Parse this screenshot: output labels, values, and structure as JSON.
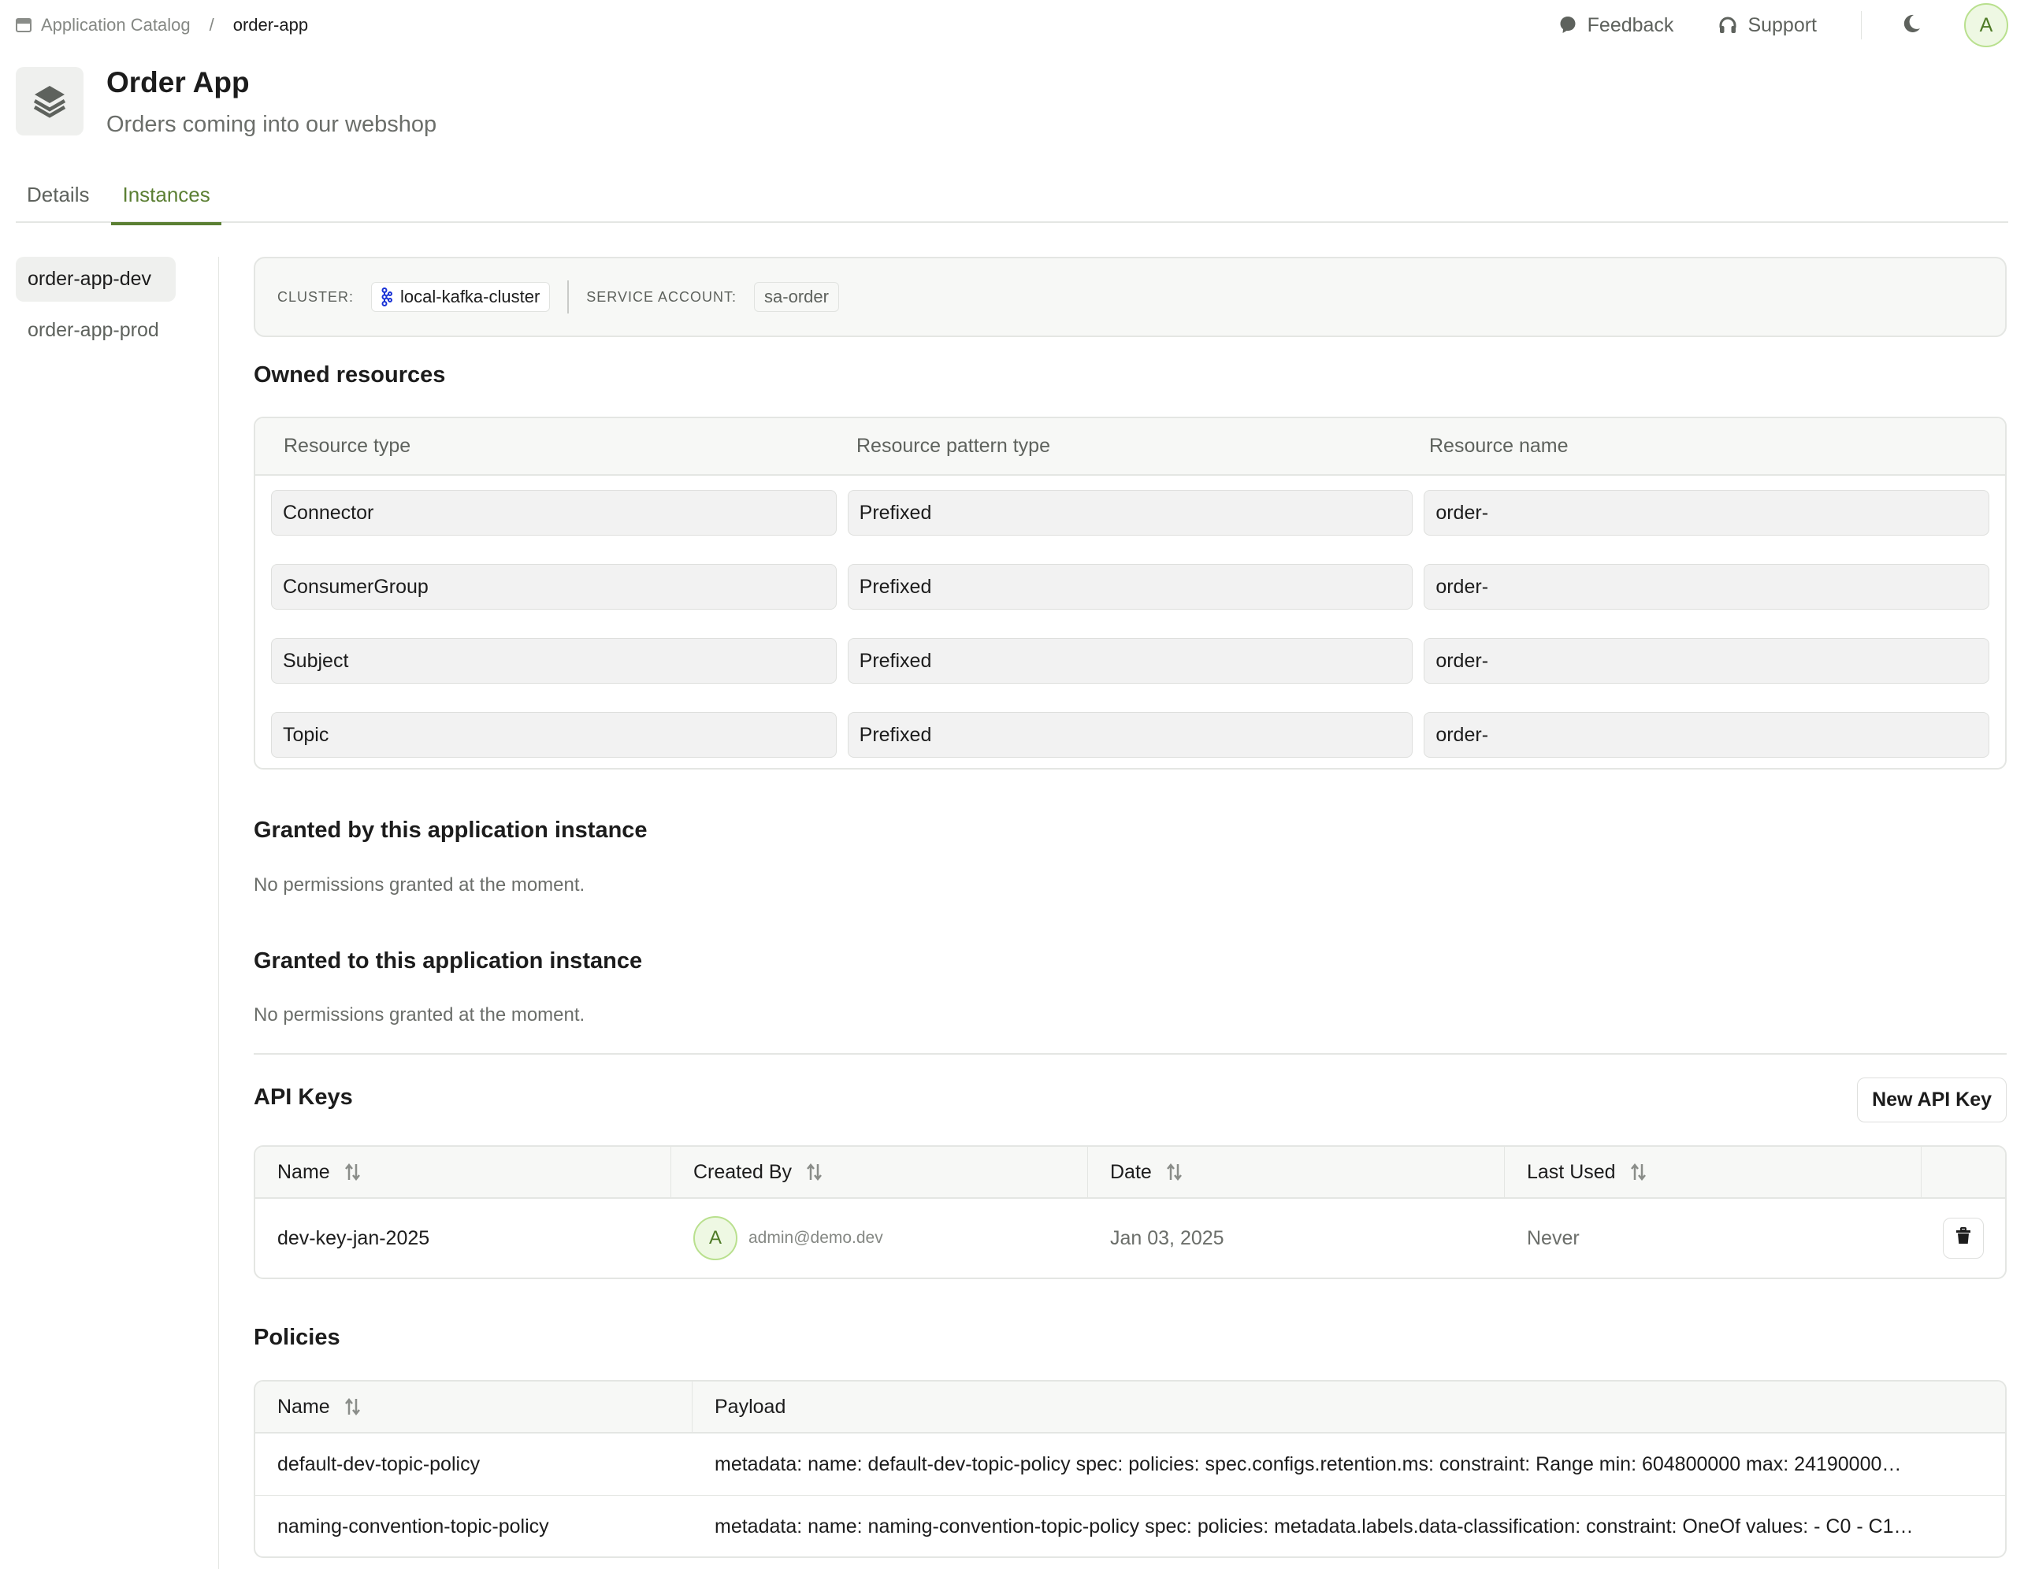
{
  "breadcrumb": {
    "icon": "app-window-icon",
    "parent": "Application Catalog",
    "separator": "/",
    "current": "order-app"
  },
  "topbar": {
    "feedback": {
      "label": "Feedback",
      "icon": "chat-bubble-icon"
    },
    "support": {
      "label": "Support",
      "icon": "headphones-icon"
    },
    "theme_toggle_icon": "moon-icon",
    "user_initial": "A"
  },
  "header": {
    "icon": "layers-icon",
    "title": "Order App",
    "subtitle": "Orders coming into our webshop"
  },
  "tabs": [
    {
      "label": "Details",
      "active": false
    },
    {
      "label": "Instances",
      "active": true
    }
  ],
  "instances": [
    {
      "label": "order-app-dev",
      "active": true
    },
    {
      "label": "order-app-prod",
      "active": false
    }
  ],
  "cluster_info": {
    "cluster_label": "CLUSTER:",
    "cluster_value": "local-kafka-cluster",
    "cluster_icon": "kafka-icon",
    "service_account_label": "SERVICE ACCOUNT:",
    "service_account_value": "sa-order"
  },
  "owned_resources": {
    "title": "Owned resources",
    "columns": [
      "Resource type",
      "Resource pattern type",
      "Resource name"
    ],
    "rows": [
      [
        "Connector",
        "Prefixed",
        "order-"
      ],
      [
        "ConsumerGroup",
        "Prefixed",
        "order-"
      ],
      [
        "Subject",
        "Prefixed",
        "order-"
      ],
      [
        "Topic",
        "Prefixed",
        "order-"
      ]
    ]
  },
  "granted_by": {
    "title": "Granted by this application instance",
    "empty": "No permissions granted at the moment."
  },
  "granted_to": {
    "title": "Granted to this application instance",
    "empty": "No permissions granted at the moment."
  },
  "api_keys": {
    "title": "API Keys",
    "new_button": "New API Key",
    "columns": [
      "Name",
      "Created By",
      "Date",
      "Last Used"
    ],
    "rows": [
      {
        "name": "dev-key-jan-2025",
        "created_by_initial": "A",
        "created_by": "admin@demo.dev",
        "date": "Jan 03, 2025",
        "last_used": "Never",
        "action_icon": "trash-icon"
      }
    ]
  },
  "policies": {
    "title": "Policies",
    "columns": [
      "Name",
      "Payload"
    ],
    "rows": [
      {
        "name": "default-dev-topic-policy",
        "payload": "metadata: name: default-dev-topic-policy spec: policies: spec.configs.retention.ms: constraint: Range min: 604800000 max: 24190000…"
      },
      {
        "name": "naming-convention-topic-policy",
        "payload": "metadata: name: naming-convention-topic-policy spec: policies: metadata.labels.data-classification: constraint: OneOf values: - C0 - C1…"
      }
    ]
  },
  "colors": {
    "accent": "#5b7f33",
    "avatar_bg": "#eef8e3",
    "avatar_border": "#b9e08e",
    "kafka_icon": "#1a33d6"
  }
}
